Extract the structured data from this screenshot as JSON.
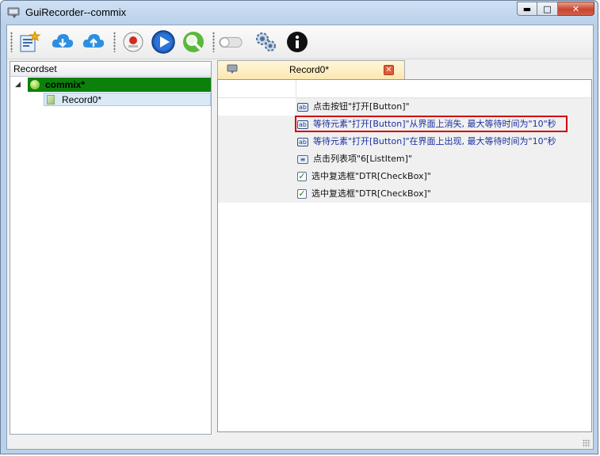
{
  "window": {
    "title": "GuiRecorder--commix",
    "buttons": {
      "minimize": "minimize",
      "maximize": "maximize",
      "close": "close"
    }
  },
  "toolbar": {
    "buttons": [
      {
        "name": "new-record-icon"
      },
      {
        "name": "download-cloud-icon"
      },
      {
        "name": "upload-cloud-icon"
      },
      {
        "name": "record-icon"
      },
      {
        "name": "play-icon"
      },
      {
        "name": "inspect-icon"
      },
      {
        "name": "toggle-icon"
      },
      {
        "name": "settings-icon"
      },
      {
        "name": "info-icon"
      }
    ]
  },
  "recordset": {
    "header": "Recordset",
    "root": {
      "label": "commix*",
      "expanded": true
    },
    "children": [
      {
        "label": "Record0*"
      }
    ]
  },
  "editor": {
    "tab_label": "Record0*",
    "rows": [
      {
        "icon": "ab",
        "text": "点击按钮\"打开[Button]\"",
        "color": "#111111"
      },
      {
        "icon": "ab",
        "text": "等待元素\"打开[Button]\"从界面上消失, 最大等待时间为\"10\"秒",
        "color": "#1b2fa0",
        "highlighted": true
      },
      {
        "icon": "ab",
        "text": "等待元素\"打开[Button]\"在界面上出现, 最大等待时间为\"10\"秒",
        "color": "#1b2fa0"
      },
      {
        "icon": "list",
        "text": "点击列表项\"6[ListItem]\"",
        "color": "#111111"
      },
      {
        "icon": "check",
        "text": "选中复选框\"DTR[CheckBox]\"",
        "color": "#111111"
      },
      {
        "icon": "check",
        "text": "选中复选框\"DTR[CheckBox]\"",
        "color": "#111111"
      }
    ]
  },
  "colors": {
    "selected_node": "#0b800b",
    "highlight_border": "#d10000"
  }
}
